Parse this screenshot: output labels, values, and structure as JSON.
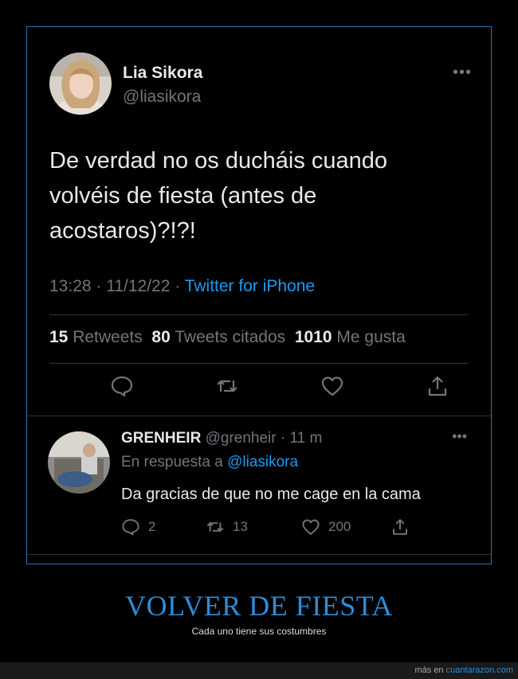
{
  "tweet": {
    "name": "Lia Sikora",
    "handle": "@liasikora",
    "text": "De verdad no os ducháis cuando volvéis de fiesta (antes de acostaros)?!?!",
    "time": "13:28 · 11/12/22 · ",
    "source": "Twitter for iPhone",
    "stats": {
      "retweets_count": "15",
      "retweets_label": "Retweets",
      "quotes_count": "80",
      "quotes_label": "Tweets citados",
      "likes_count": "1010",
      "likes_label": "Me gusta"
    },
    "more": "•••"
  },
  "reply": {
    "name": "GRENHEIR",
    "handle_time": " @grenheir · 11 m",
    "in_reply_prefix": "En respuesta a ",
    "in_reply_handle": "@liasikora",
    "text": "Da gracias de que no me cage en la cama",
    "reply_count": "2",
    "retweet_count": "13",
    "like_count": "200",
    "more": "•••"
  },
  "caption": {
    "title": "VOLVER DE FIESTA",
    "subtitle": "Cada uno tiene sus costumbres"
  },
  "footer": {
    "prefix": "más en ",
    "site": "cuantarazon.com"
  },
  "colors": {
    "accent": "#1d9bf0",
    "caption": "#2f8bd6",
    "muted": "#71767b"
  }
}
